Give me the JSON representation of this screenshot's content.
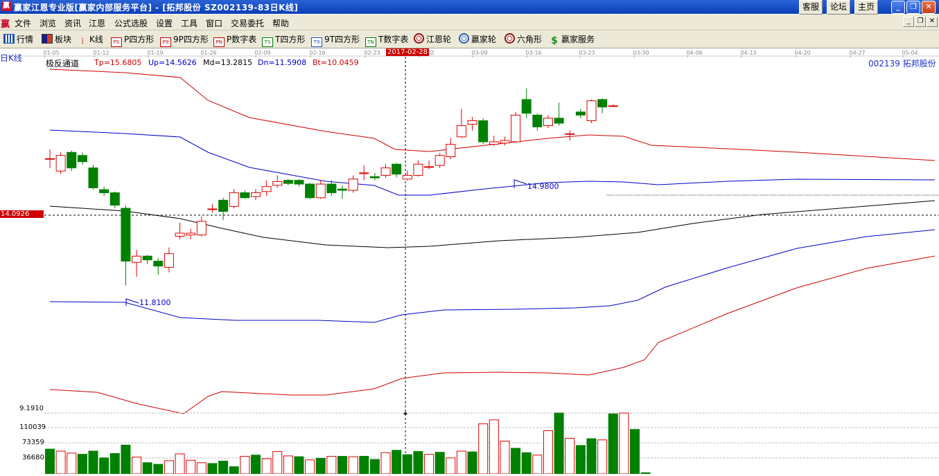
{
  "titlebar": {
    "title": "赢家江恩专业版[赢家内部服务平台] - [拓邦股份   SZ002139-83日K线]",
    "btn_service": "客服",
    "btn_forum": "论坛",
    "btn_home": "主页",
    "icon_text": "赢"
  },
  "menubar": {
    "logo": "赢",
    "items": [
      "文件",
      "浏览",
      "资讯",
      "江恩",
      "公式选股",
      "设置",
      "工具",
      "窗口",
      "交易委托",
      "帮助"
    ]
  },
  "toolbar": {
    "items": [
      {
        "label": "行情",
        "icon": "grid-icon"
      },
      {
        "label": "板块",
        "icon": "blocks-icon"
      },
      {
        "label": "K线",
        "icon": "kline-icon"
      },
      {
        "label": "P四方形",
        "icon": "ps-icon",
        "icon_text": "PS"
      },
      {
        "label": "9P四方形",
        "icon": "p9-icon",
        "icon_text": "P9"
      },
      {
        "label": "P数字表",
        "icon": "pn-icon",
        "icon_text": "PN"
      },
      {
        "label": "T四方形",
        "icon": "ts-icon",
        "icon_text": "TS"
      },
      {
        "label": "9T四方形",
        "icon": "t9-icon",
        "icon_text": "T9"
      },
      {
        "label": "T数字表",
        "icon": "tn-icon",
        "icon_text": "TN"
      },
      {
        "label": "江恩轮",
        "icon": "gann-wheel-icon"
      },
      {
        "label": "赢家轮",
        "icon": "winner-wheel-icon"
      },
      {
        "label": "六角形",
        "icon": "hexagon-icon"
      },
      {
        "label": "赢家服务",
        "icon": "dollar-icon"
      }
    ]
  },
  "chart": {
    "period_label": "日K线",
    "indicator_name": "极反通道",
    "tp": "Tp=15.6805",
    "up": "Up=14.5626",
    "md": "Md=13.2815",
    "dn": "Dn=11.5908",
    "bt": "Bt=10.0459",
    "stock": "002139  拓邦股份",
    "cursor_date": "2017-02-28",
    "cursor_price": "14.0926",
    "high_label": "14.9800",
    "low_label": "11.8100",
    "date_ticks": [
      "01-05",
      "01-12",
      "01-19",
      "01-26",
      "02-09",
      "02-16",
      "02-23",
      "03-02",
      "03-09",
      "03-16",
      "03-23",
      "03-30",
      "04-06",
      "04-13",
      "04-20",
      "04-27",
      "05-04"
    ],
    "volume_axis_labels": [
      "9.1910",
      "110039",
      "73359",
      "36680"
    ],
    "colors": {
      "up": "#e00000",
      "down": "#008000",
      "mid": "#000000",
      "inner": "#0000c8",
      "outer": "#d00000"
    }
  },
  "chart_data": {
    "type": "candlestick",
    "title": "极反通道",
    "candles": [
      {
        "o": 13.85,
        "c": 13.85,
        "h": 14.0,
        "l": 13.7
      },
      {
        "o": 13.65,
        "c": 13.9,
        "h": 13.95,
        "l": 13.6
      },
      {
        "o": 13.95,
        "c": 13.7,
        "h": 13.98,
        "l": 13.65
      },
      {
        "o": 13.9,
        "c": 13.8,
        "h": 13.95,
        "l": 13.75
      },
      {
        "o": 13.7,
        "c": 13.38,
        "h": 13.75,
        "l": 13.35
      },
      {
        "o": 13.35,
        "c": 13.3,
        "h": 13.4,
        "l": 13.25
      },
      {
        "o": 13.3,
        "c": 13.1,
        "h": 13.32,
        "l": 13.05
      },
      {
        "o": 13.05,
        "c": 12.2,
        "h": 13.1,
        "l": 11.81
      },
      {
        "o": 12.18,
        "c": 12.28,
        "h": 12.38,
        "l": 11.95
      },
      {
        "o": 12.28,
        "c": 12.22,
        "h": 12.3,
        "l": 12.15
      },
      {
        "o": 12.2,
        "c": 12.12,
        "h": 12.25,
        "l": 11.98
      },
      {
        "o": 12.1,
        "c": 12.32,
        "h": 12.42,
        "l": 12.02
      },
      {
        "o": 12.6,
        "c": 12.65,
        "h": 12.82,
        "l": 12.55
      },
      {
        "o": 12.62,
        "c": 12.65,
        "h": 12.72,
        "l": 12.55
      },
      {
        "o": 12.62,
        "c": 12.84,
        "h": 12.92,
        "l": 12.6
      },
      {
        "o": 13.04,
        "c": 13.04,
        "h": 13.12,
        "l": 12.98
      },
      {
        "o": 13.18,
        "c": 13.0,
        "h": 13.22,
        "l": 12.86
      },
      {
        "o": 13.08,
        "c": 13.3,
        "h": 13.36,
        "l": 13.05
      },
      {
        "o": 13.3,
        "c": 13.22,
        "h": 13.34,
        "l": 13.2
      },
      {
        "o": 13.24,
        "c": 13.3,
        "h": 13.36,
        "l": 13.18
      },
      {
        "o": 13.32,
        "c": 13.4,
        "h": 13.5,
        "l": 13.25
      },
      {
        "o": 13.42,
        "c": 13.48,
        "h": 13.58,
        "l": 13.38
      },
      {
        "o": 13.5,
        "c": 13.45,
        "h": 13.52,
        "l": 13.42
      },
      {
        "o": 13.5,
        "c": 13.44,
        "h": 13.52,
        "l": 13.4
      },
      {
        "o": 13.44,
        "c": 13.22,
        "h": 13.46,
        "l": 13.2
      },
      {
        "o": 13.22,
        "c": 13.44,
        "h": 13.5,
        "l": 13.2
      },
      {
        "o": 13.44,
        "c": 13.3,
        "h": 13.5,
        "l": 13.25
      },
      {
        "o": 13.36,
        "c": 13.34,
        "h": 13.42,
        "l": 13.2
      },
      {
        "o": 13.34,
        "c": 13.52,
        "h": 13.58,
        "l": 13.3
      },
      {
        "o": 13.62,
        "c": 13.62,
        "h": 13.74,
        "l": 13.5
      },
      {
        "o": 13.56,
        "c": 13.54,
        "h": 13.62,
        "l": 13.5
      },
      {
        "o": 13.58,
        "c": 13.7,
        "h": 13.76,
        "l": 13.54
      },
      {
        "o": 13.76,
        "c": 13.6,
        "h": 13.78,
        "l": 13.55
      },
      {
        "o": 13.52,
        "c": 13.58,
        "h": 13.66,
        "l": 13.5
      },
      {
        "o": 13.58,
        "c": 13.76,
        "h": 13.82,
        "l": 13.56
      },
      {
        "o": 13.72,
        "c": 13.72,
        "h": 13.82,
        "l": 13.68
      },
      {
        "o": 13.74,
        "c": 13.9,
        "h": 13.94,
        "l": 13.7
      },
      {
        "o": 13.88,
        "c": 14.08,
        "h": 14.18,
        "l": 13.84
      },
      {
        "o": 14.2,
        "c": 14.38,
        "h": 14.65,
        "l": 14.18
      },
      {
        "o": 14.4,
        "c": 14.46,
        "h": 14.52,
        "l": 14.3
      },
      {
        "o": 14.46,
        "c": 14.12,
        "h": 14.5,
        "l": 14.08
      },
      {
        "o": 14.08,
        "c": 14.12,
        "h": 14.22,
        "l": 14.05
      },
      {
        "o": 14.1,
        "c": 14.14,
        "h": 14.2,
        "l": 14.06
      },
      {
        "o": 14.12,
        "c": 14.55,
        "h": 14.6,
        "l": 14.1
      },
      {
        "o": 14.8,
        "c": 14.58,
        "h": 14.98,
        "l": 14.5
      },
      {
        "o": 14.55,
        "c": 14.36,
        "h": 14.58,
        "l": 14.3
      },
      {
        "o": 14.38,
        "c": 14.5,
        "h": 14.55,
        "l": 14.34
      },
      {
        "o": 14.5,
        "c": 14.42,
        "h": 14.75,
        "l": 14.38
      },
      {
        "o": 14.25,
        "c": 14.25,
        "h": 14.3,
        "l": 14.14
      },
      {
        "o": 14.6,
        "c": 14.55,
        "h": 14.65,
        "l": 14.5
      },
      {
        "o": 14.46,
        "c": 14.78,
        "h": 14.8,
        "l": 14.42
      },
      {
        "o": 14.8,
        "c": 14.68,
        "h": 14.82,
        "l": 14.58
      },
      {
        "o": 14.7,
        "c": 14.7,
        "h": 14.72,
        "l": 14.68
      }
    ],
    "volumes": [
      62000,
      57000,
      52000,
      49000,
      57000,
      40000,
      51000,
      72000,
      42000,
      28000,
      24000,
      33000,
      50000,
      34000,
      28000,
      26000,
      32000,
      18000,
      44000,
      47000,
      38000,
      56000,
      45000,
      43000,
      35000,
      39000,
      44000,
      44000,
      43000,
      44000,
      36000,
      53000,
      59000,
      48000,
      56000,
      49000,
      54000,
      40000,
      57000,
      55000,
      125000,
      135000,
      82000,
      64000,
      53000,
      47000,
      108000,
      152000,
      89000,
      71000,
      88000,
      85000,
      150000,
      152000,
      111000,
      3000
    ],
    "volume_up": [
      false,
      true,
      true,
      false,
      false,
      false,
      false,
      false,
      true,
      false,
      false,
      true,
      true,
      true,
      true,
      false,
      false,
      false,
      true,
      false,
      true,
      true,
      true,
      false,
      true,
      false,
      true,
      false,
      true,
      false,
      false,
      true,
      false,
      false,
      false,
      true,
      false,
      true,
      true,
      false,
      true,
      true,
      true,
      false,
      false,
      true,
      true,
      false,
      true,
      false,
      false,
      true,
      false,
      true,
      false,
      false
    ],
    "ylim": [
      10.0,
      15.4
    ],
    "vlim": [
      0,
      152000
    ]
  }
}
